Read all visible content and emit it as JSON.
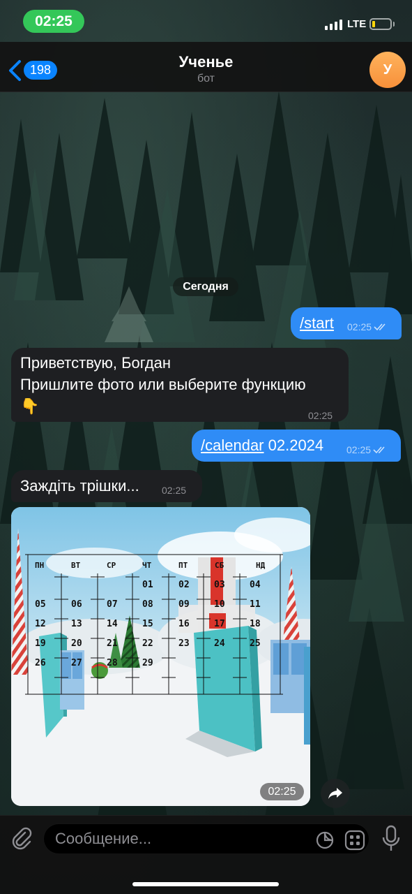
{
  "status_bar": {
    "time": "02:25",
    "network": "LTE",
    "battery_color": "#ffd60a",
    "time_pill_color": "#34c759"
  },
  "header": {
    "back_count": "198",
    "title": "Ученье",
    "subtitle": "бот",
    "avatar_letter": "У",
    "avatar_color": "#f7903a",
    "accent": "#0a84ff"
  },
  "chat": {
    "date_separator": "Сегодня",
    "messages": [
      {
        "direction": "out",
        "command": "/start",
        "rest": "",
        "time": "02:25",
        "status": "read-double-check"
      },
      {
        "direction": "in",
        "line1": "Приветствую, Богдан",
        "line2": "Пришлите фото или выберите функцию",
        "emoji": "👇",
        "time": "02:25"
      },
      {
        "direction": "out",
        "command": "/calendar",
        "rest": " 02.2024",
        "time": "02:25",
        "status": "read-double-check"
      },
      {
        "direction": "in",
        "text": "Заждіть трішки...",
        "time": "02:25"
      },
      {
        "direction": "in",
        "type": "photo",
        "time": "02:25"
      }
    ],
    "bubble_out_color": "#2f8cf6",
    "bubble_in_color": "#1e1f22"
  },
  "calendar_image": {
    "weekdays": [
      "ПН",
      "ВТ",
      "СР",
      "ЧТ",
      "ПТ",
      "СБ",
      "НД"
    ],
    "weeks": [
      [
        "",
        "",
        "",
        "01",
        "02",
        "03",
        "04"
      ],
      [
        "05",
        "06",
        "07",
        "08",
        "09",
        "10",
        "11"
      ],
      [
        "12",
        "13",
        "14",
        "15",
        "16",
        "17",
        "18"
      ],
      [
        "19",
        "20",
        "21",
        "22",
        "23",
        "24",
        "25"
      ],
      [
        "26",
        "27",
        "28",
        "29",
        "",
        "",
        ""
      ]
    ],
    "highlighted_day": "17"
  },
  "input": {
    "placeholder": "Сообщение..."
  }
}
